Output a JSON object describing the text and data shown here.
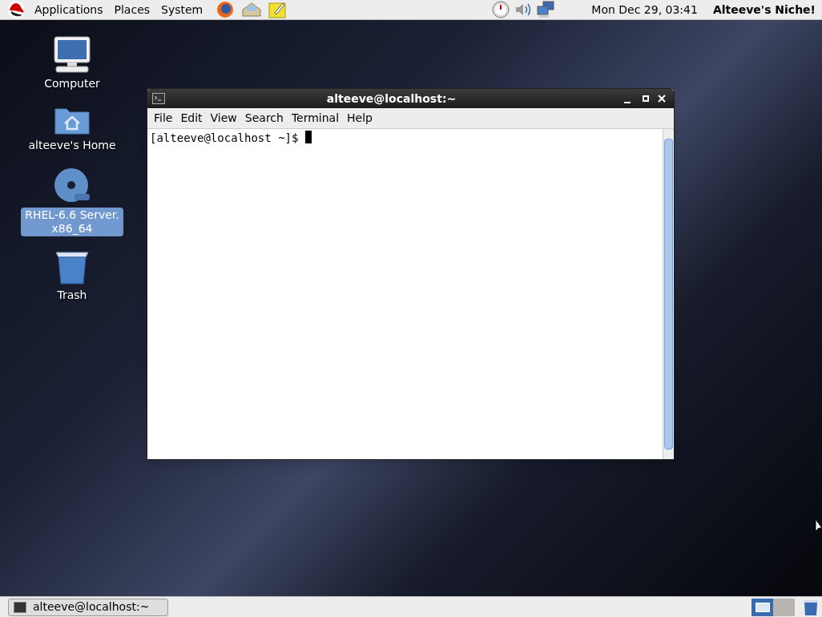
{
  "top_panel": {
    "menus": [
      "Applications",
      "Places",
      "System"
    ],
    "clock": "Mon Dec 29, 03:41",
    "user": "Alteeve's Niche!"
  },
  "desktop_icons": [
    {
      "kind": "computer",
      "label": "Computer",
      "selected": false
    },
    {
      "kind": "home",
      "label": "alteeve's Home",
      "selected": false
    },
    {
      "kind": "dvd",
      "label": "RHEL-6.6 Server.\nx86_64",
      "selected": true
    },
    {
      "kind": "trash",
      "label": "Trash",
      "selected": false
    }
  ],
  "terminal": {
    "title": "alteeve@localhost:~",
    "menus": [
      "File",
      "Edit",
      "View",
      "Search",
      "Terminal",
      "Help"
    ],
    "prompt": "[alteeve@localhost ~]$"
  },
  "bottom_panel": {
    "tasks": [
      {
        "label": "alteeve@localhost:~"
      }
    ],
    "workspaces": [
      {
        "selected": true
      },
      {
        "selected": false
      }
    ]
  }
}
